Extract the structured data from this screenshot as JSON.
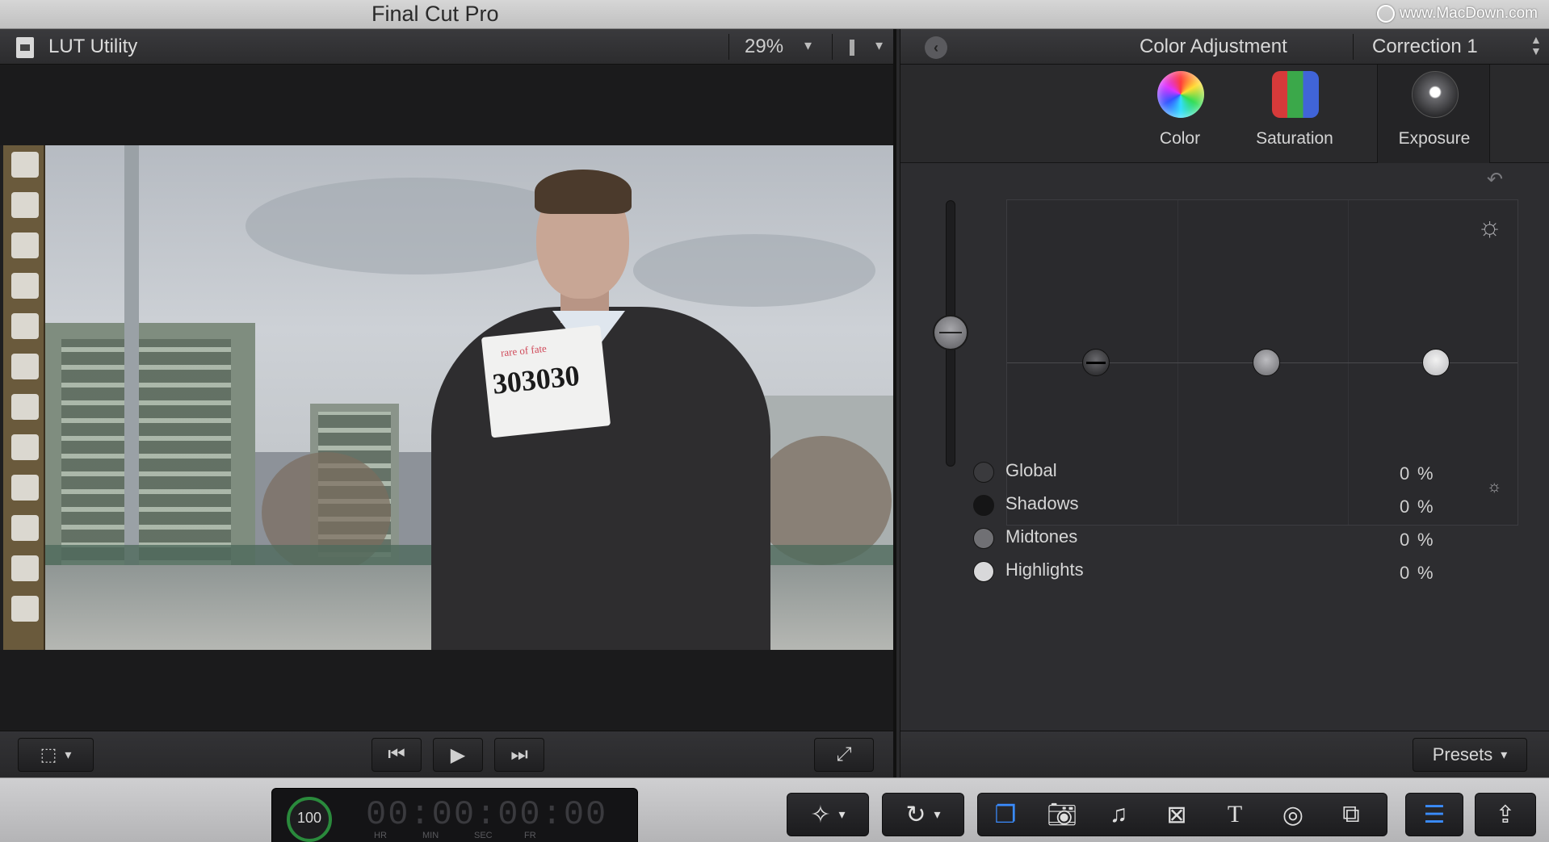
{
  "window": {
    "title": "Final Cut Pro",
    "watermark": "www.MacDown.com"
  },
  "viewer": {
    "name": "LUT Utility",
    "zoom": "29%",
    "tag_small": "rare of fate",
    "tag_number": "303030",
    "controls": {
      "prev": "⏮",
      "play": "▶",
      "next": "⏭",
      "fullscreen": "⤢",
      "view": "⬚",
      "caret": "▾"
    }
  },
  "inspector": {
    "title": "Color Adjustment",
    "correction": "Correction 1",
    "tabs": [
      {
        "label": "Color",
        "icon": "color-wheel-icon"
      },
      {
        "label": "Saturation",
        "icon": "saturation-icon"
      },
      {
        "label": "Exposure",
        "icon": "exposure-icon",
        "active": true
      }
    ],
    "rows": [
      {
        "label": "Global",
        "value": "0",
        "unit": "%",
        "dot": "#3a3a3d"
      },
      {
        "label": "Shadows",
        "value": "0",
        "unit": "%",
        "dot": "#151516"
      },
      {
        "label": "Midtones",
        "value": "0",
        "unit": "%",
        "dot": "#707074"
      },
      {
        "label": "Highlights",
        "value": "0",
        "unit": "%",
        "dot": "#d8d8da"
      }
    ],
    "presets": "Presets"
  },
  "toolbar": {
    "meter": "100",
    "timecode": "00:00:00:00",
    "units": [
      "HR",
      "MIN",
      "SEC",
      "FR"
    ]
  },
  "colors": {
    "accent": "#3a8cff",
    "meter_ring": "#2a8a3c"
  }
}
